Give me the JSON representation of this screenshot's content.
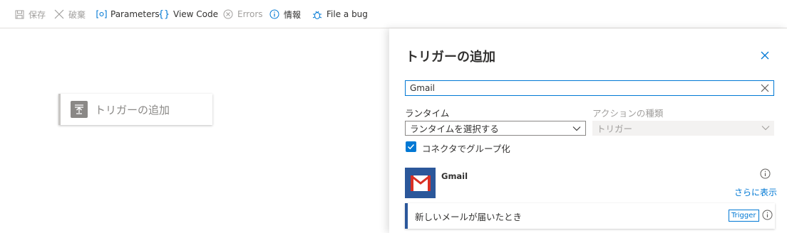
{
  "toolbar": {
    "save": "保存",
    "discard": "破棄",
    "parameters": "Parameters",
    "view_code": "View Code",
    "errors": "Errors",
    "info": "情報",
    "file_bug": "File a bug"
  },
  "canvas": {
    "node_label": "トリガーの追加"
  },
  "panel": {
    "title": "トリガーの追加",
    "search_value": "Gmail",
    "runtime_label": "ランタイム",
    "runtime_value": "ランタイムを選択する",
    "action_type_label": "アクションの種類",
    "action_type_value": "トリガー",
    "group_by_connector_label": "コネクタでグループ化",
    "group_by_connector_checked": true,
    "connector": {
      "name": "Gmail",
      "more_link": "さらに表示"
    },
    "trigger": {
      "label": "新しいメールが届いたとき",
      "badge": "Trigger"
    }
  },
  "colors": {
    "accent": "#0078d4",
    "gmail_tile": "#2b579a",
    "disabled_text": "#a19f9d"
  }
}
